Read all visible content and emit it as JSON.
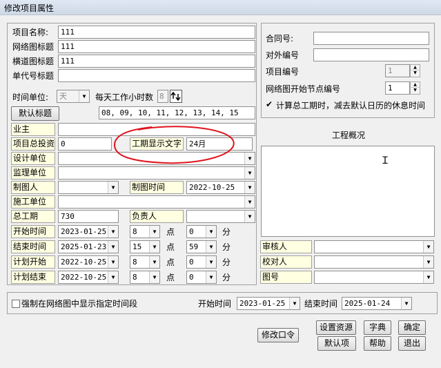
{
  "title": "修改项目属性",
  "left": {
    "project_name_label": "项目名称:",
    "project_name_value": "111",
    "network_title_label": "网络图标题",
    "network_title_value": "111",
    "bar_title_label": "横道图标题",
    "bar_title_value": "111",
    "code_title_label": "单代号标题",
    "code_title_value": "",
    "time_unit_label": "时间单位:",
    "time_unit_value": "天",
    "work_hours_label": "每天工作小时数",
    "work_hours_value": "8",
    "default_title_button": "默认标题",
    "hours_list": "08, 09, 10, 11, 12, 13, 14, 15",
    "owner_label": "业主",
    "total_invest_label": "项目总投资",
    "total_invest_value": "0",
    "period_text_label": "工期显示文字",
    "period_text_value": "24月",
    "design_unit_label": "设计单位",
    "supervise_unit_label": "监理单位",
    "drafter_label": "制图人",
    "draw_time_label": "制图时间",
    "draw_time_value": "2022-10-25",
    "build_unit_label": "施工单位",
    "total_period_label": "总工期",
    "total_period_value": "730",
    "manager_label": "负责人",
    "start_label": "开始时间",
    "start_date": "2023-01-25",
    "start_hour": "8",
    "start_min": "0",
    "end_label": "结束时间",
    "end_date": "2025-01-23",
    "end_hour": "15",
    "end_min": "59",
    "plan_start_label": "计划开始",
    "plan_start_date": "2022-10-25",
    "plan_start_hour": "8",
    "plan_start_min": "0",
    "plan_end_label": "计划结束",
    "plan_end_date": "2022-10-25",
    "plan_end_hour": "8",
    "plan_end_min": "0",
    "point_label": "点",
    "minute_label": "分"
  },
  "right": {
    "contract_label": "合同号:",
    "external_code_label": "对外编号",
    "project_code_label": "项目编号",
    "project_code_value": "1",
    "start_node_label": "网络图开始节点编号",
    "start_node_value": "1",
    "calc_checkbox_label": "计算总工期时，减去默认日历的休息时间",
    "overview_label": "工程概况",
    "reviewer_label": "审核人",
    "checker_label": "校对人",
    "drawing_no_label": "图号"
  },
  "bottom": {
    "force_label": "强制在网络图中显示指定时间段",
    "start_time_label": "开始时间",
    "start_time_value": "2023-01-25",
    "end_time_label": "结束时间",
    "end_time_value": "2025-01-24",
    "change_password_button": "修改口令",
    "set_resource_button": "设置资源",
    "dictionary_button": "字典",
    "ok_button": "确定",
    "default_button": "默认项",
    "help_button": "帮助",
    "exit_button": "退出"
  },
  "colors": {
    "annotation": "#e0141e",
    "label_bg": "#ffffe1",
    "window_bg": "#f0f0f0"
  }
}
